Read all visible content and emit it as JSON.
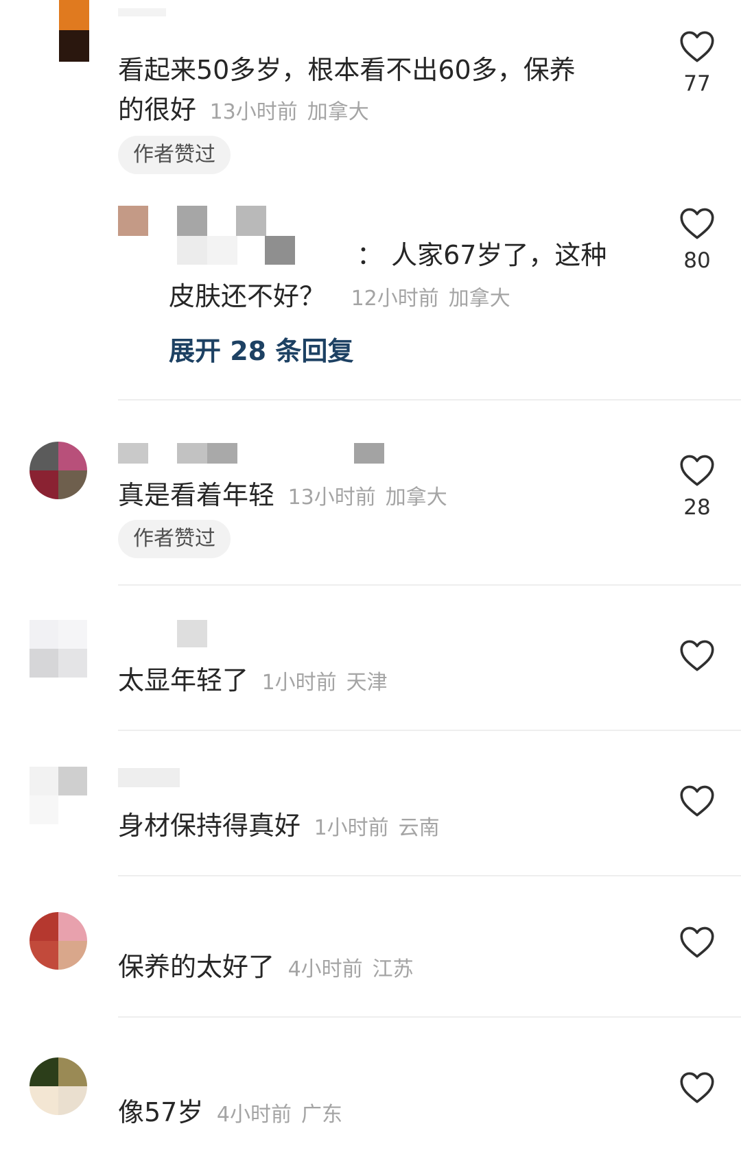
{
  "comments": [
    {
      "text": "看起来50多岁，根本看不出60多，保养",
      "text2": "的很好",
      "time": "13小时前",
      "location": "加拿大",
      "badge": "作者赞过",
      "likes": "77",
      "reply": {
        "text": "：  人家67岁了，这种",
        "text2": "皮肤还不好？",
        "time": "12小时前",
        "location": "加拿大",
        "likes": "80"
      },
      "expand_label": "展开 28 条回复"
    },
    {
      "text": "真是看着年轻",
      "time": "13小时前",
      "location": "加拿大",
      "badge": "作者赞过",
      "likes": "28"
    },
    {
      "text": "太显年轻了",
      "time": "1小时前",
      "location": "天津"
    },
    {
      "text": "身材保持得真好",
      "time": "1小时前",
      "location": "云南"
    },
    {
      "text": "保养的太好了",
      "time": "4小时前",
      "location": "江苏"
    },
    {
      "text": "像57岁",
      "time": "4小时前",
      "location": "广东"
    }
  ],
  "icons": {
    "like": "heart-outline-icon"
  },
  "colors": {
    "link": "#1d4163",
    "meta": "#a4a4a4",
    "chip_bg": "#f2f2f2"
  }
}
